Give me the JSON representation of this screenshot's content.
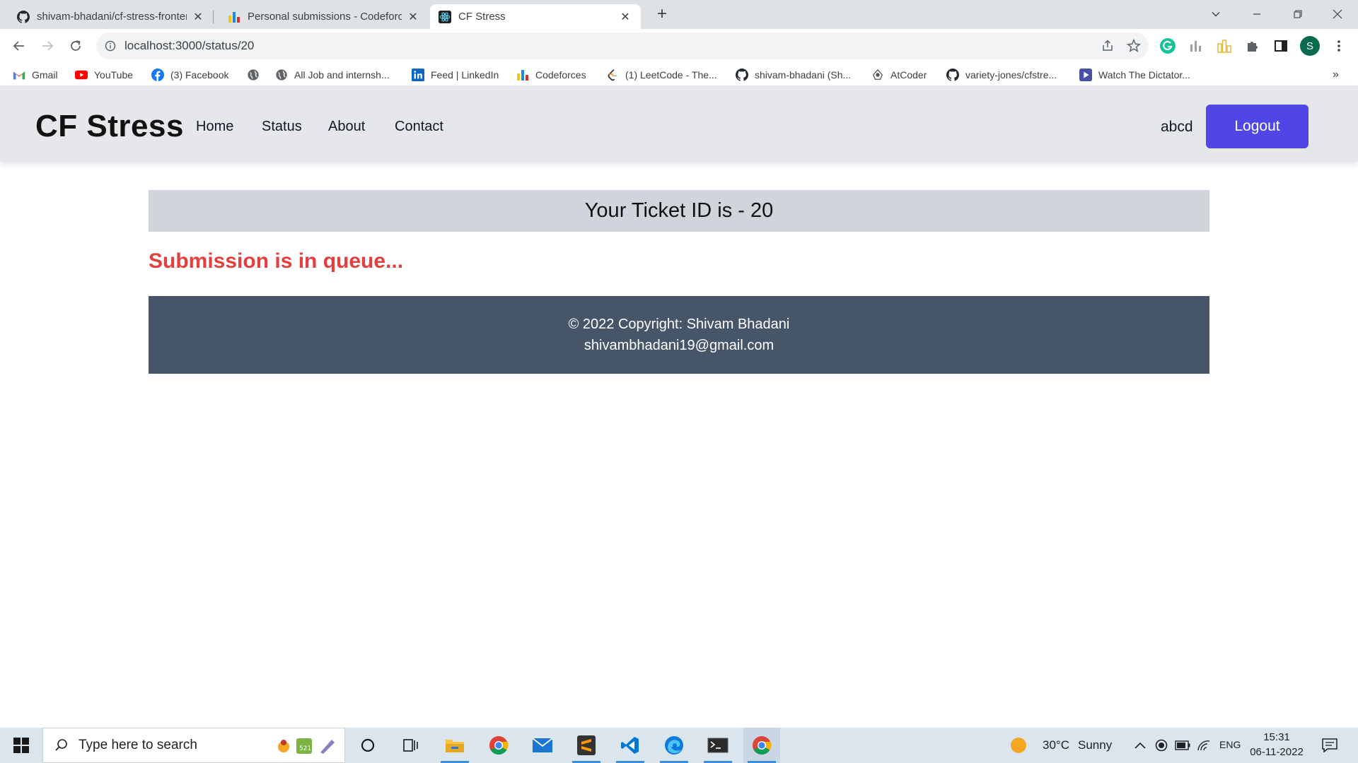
{
  "browser": {
    "tabs": [
      {
        "title": "shivam-bhadani/cf-stress-frontend",
        "active": false,
        "icon": "github-icon"
      },
      {
        "title": "Personal submissions - Codeforces",
        "active": false,
        "icon": "codeforces-icon"
      },
      {
        "title": "CF Stress",
        "active": true,
        "icon": "react-icon"
      }
    ],
    "new_tab": "+",
    "url": "localhost:3000/status/20",
    "profile_initial": "S",
    "bookmarks": [
      {
        "label": "Gmail",
        "icon": "gmail-icon"
      },
      {
        "label": "YouTube",
        "icon": "youtube-icon"
      },
      {
        "label": "(3) Facebook",
        "icon": "facebook-icon"
      },
      {
        "label": "",
        "icon": "globe-icon"
      },
      {
        "label": "All Job and internsh...",
        "icon": "globe-icon"
      },
      {
        "label": "Feed | LinkedIn",
        "icon": "linkedin-icon"
      },
      {
        "label": "Codeforces",
        "icon": "codeforces-icon"
      },
      {
        "label": "(1) LeetCode - The...",
        "icon": "leetcode-icon"
      },
      {
        "label": "shivam-bhadani (Sh...",
        "icon": "github-icon"
      },
      {
        "label": "AtCoder",
        "icon": "atcoder-icon"
      },
      {
        "label": "variety-jones/cfstre...",
        "icon": "github-icon"
      },
      {
        "label": "Watch The Dictator...",
        "icon": "video-icon"
      }
    ],
    "bookmarks_overflow": "»"
  },
  "site": {
    "brand": "CF Stress",
    "nav": [
      "Home",
      "Status",
      "About",
      "Contact"
    ],
    "username": "abcd",
    "logout_label": "Logout"
  },
  "main": {
    "ticket_text": "Your Ticket ID is - 20",
    "status_message": "Submission is in queue..."
  },
  "footer": {
    "copyright": "© 2022 Copyright: Shivam Bhadani",
    "email": "shivambhadani19@gmail.com"
  },
  "taskbar": {
    "search_placeholder": "Type here to search",
    "weather_temp": "30°C",
    "weather_desc": "Sunny",
    "language": "ENG",
    "time": "15:31",
    "date": "06-11-2022"
  },
  "colors": {
    "accent": "#4f46e5",
    "status_text": "#e53e3e",
    "footer_bg": "#475569",
    "ticket_bg": "#d1d5db",
    "navbar_bg": "#e5e7eb"
  }
}
